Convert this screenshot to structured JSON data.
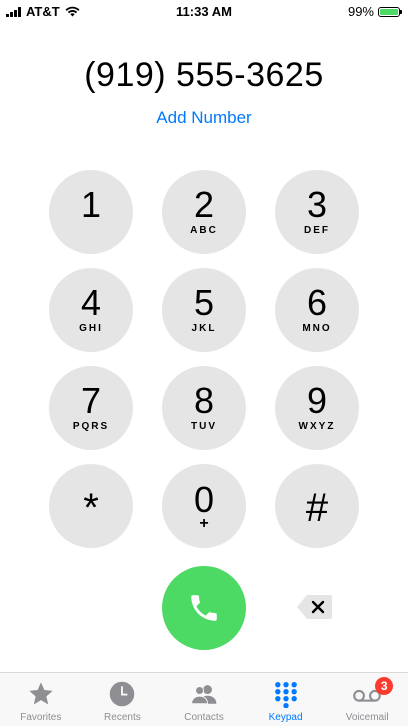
{
  "status_bar": {
    "carrier": "AT&T",
    "time": "11:33 AM",
    "battery_percent": "99%",
    "battery_level": 0.99,
    "battery_color": "#4cd964"
  },
  "dialer": {
    "number": "(919) 555-3625",
    "add_number_label": "Add Number",
    "link_color": "#007aff"
  },
  "keypad": {
    "keys": [
      {
        "digit": "1",
        "letters": ""
      },
      {
        "digit": "2",
        "letters": "ABC"
      },
      {
        "digit": "3",
        "letters": "DEF"
      },
      {
        "digit": "4",
        "letters": "GHI"
      },
      {
        "digit": "5",
        "letters": "JKL"
      },
      {
        "digit": "6",
        "letters": "MNO"
      },
      {
        "digit": "7",
        "letters": "PQRS"
      },
      {
        "digit": "8",
        "letters": "TUV"
      },
      {
        "digit": "9",
        "letters": "WXYZ"
      },
      {
        "digit": "*",
        "letters": ""
      },
      {
        "digit": "0",
        "letters": "+"
      },
      {
        "digit": "#",
        "letters": ""
      }
    ],
    "key_color": "#e5e5e5"
  },
  "call": {
    "call_icon": "phone-icon",
    "call_color": "#4cd964",
    "delete_icon": "backspace-icon"
  },
  "tab_bar": {
    "active_color": "#007aff",
    "inactive_color": "#8e8e93",
    "tabs": [
      {
        "label": "Favorites",
        "icon": "star-icon",
        "active": false
      },
      {
        "label": "Recents",
        "icon": "clock-icon",
        "active": false
      },
      {
        "label": "Contacts",
        "icon": "contacts-icon",
        "active": false
      },
      {
        "label": "Keypad",
        "icon": "keypad-icon",
        "active": true
      },
      {
        "label": "Voicemail",
        "icon": "voicemail-icon",
        "active": false,
        "badge": "3"
      }
    ],
    "badge_color": "#ff3b30"
  }
}
